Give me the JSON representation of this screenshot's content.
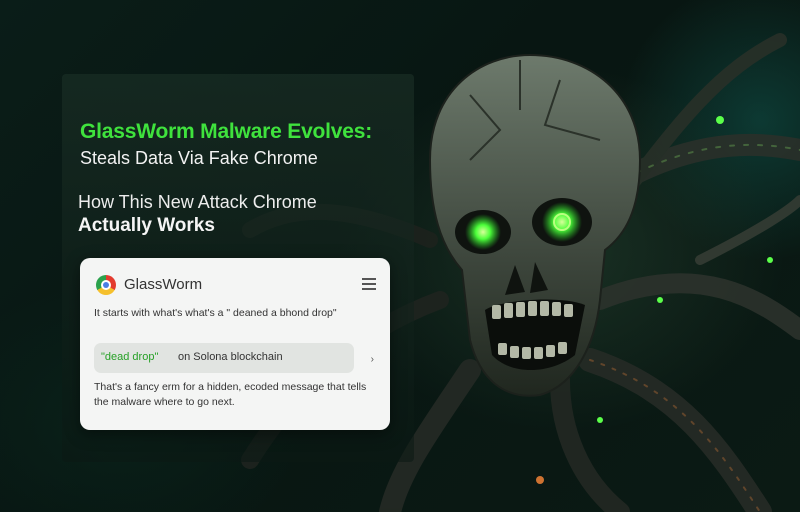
{
  "headline": "GlassWorm Malware Evolves:",
  "subheadline": "Steals Data Via Fake Chrome",
  "question_line1": "How This New Attack Chrome",
  "question_line2": "Actually Works",
  "card": {
    "title": "GlassWorm",
    "menu_icon": "hamburger-menu-icon",
    "intro_text": "It starts with what's what's a \" deaned a  bhond drop\"",
    "highlight_quote": "\"dead drop\"",
    "highlight_rest": "on  Solona blockchain",
    "chevron": "›",
    "explanation": "That's a fancy erm for a hidden, ecoded message that tells the malware where to go next."
  },
  "colors": {
    "accent_green": "#3fe23d",
    "eye_glow": "#4cff3a"
  }
}
